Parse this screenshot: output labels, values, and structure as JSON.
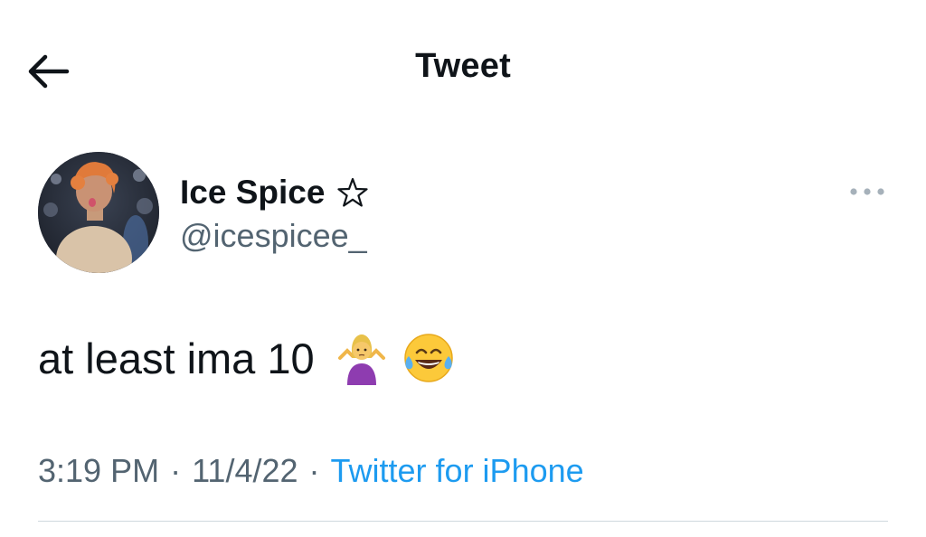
{
  "header": {
    "title": "Tweet",
    "back_icon": "back-arrow-icon"
  },
  "author": {
    "display_name": "Ice Spice",
    "handle": "@icespicee_",
    "badge_icon": "star-outline-icon",
    "avatar_icon": "avatar"
  },
  "more_icon": "more-options-icon",
  "tweet": {
    "text": "at least ima 10",
    "emojis": [
      "person-shrugging-emoji",
      "face-with-tears-of-joy-emoji"
    ]
  },
  "meta": {
    "time": "3:19 PM",
    "separator": "·",
    "date": "11/4/22",
    "source": "Twitter for iPhone"
  },
  "colors": {
    "text_primary": "#0f1419",
    "text_secondary": "#536471",
    "link": "#1d9bf0",
    "divider": "#cfd9de"
  }
}
